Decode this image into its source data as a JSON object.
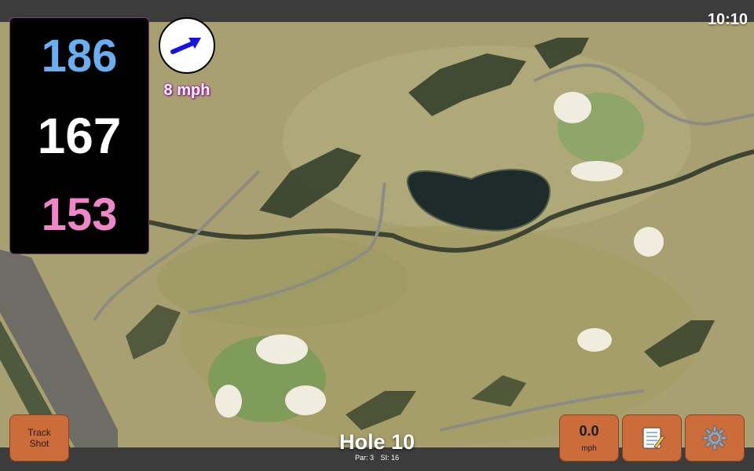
{
  "status": {
    "time": "10:10"
  },
  "distances": {
    "back": "186",
    "middle": "167",
    "front": "153"
  },
  "wind": {
    "speed": "8 mph",
    "icon": "wind-arrow-icon"
  },
  "hole": {
    "title": "Hole 10",
    "par": "Par: 3",
    "stroke_index": "SI: 16"
  },
  "buttons": {
    "track_shot_line1": "Track",
    "track_shot_line2": "Shot",
    "speed_value": "0.0",
    "speed_unit": "mph",
    "notes_icon": "notepad-icon",
    "settings_icon": "gear-icon"
  },
  "colors": {
    "back": "#6aaef0",
    "middle": "#ffffff",
    "front": "#ef86c9",
    "button": "#cc6c3b"
  }
}
